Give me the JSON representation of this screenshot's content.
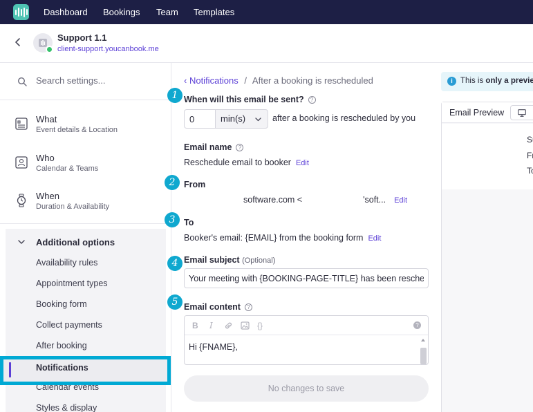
{
  "topnav": {
    "items": [
      "Dashboard",
      "Bookings",
      "Team",
      "Templates"
    ]
  },
  "header": {
    "title": "Support 1.1",
    "url": "client-support.youcanbook.me"
  },
  "sidebar": {
    "search_placeholder": "Search settings...",
    "sections": [
      {
        "title": "What",
        "subtitle": "Event details & Location"
      },
      {
        "title": "Who",
        "subtitle": "Calendar & Teams"
      },
      {
        "title": "When",
        "subtitle": "Duration & Availability"
      }
    ],
    "additional": {
      "title": "Additional options",
      "items": [
        "Availability rules",
        "Appointment types",
        "Booking form",
        "Collect payments",
        "After booking",
        "Notifications",
        "Calendar events",
        "Styles & display"
      ],
      "active": "Notifications"
    }
  },
  "main": {
    "breadcrumb": {
      "link": "Notifications",
      "separator": "/",
      "current": "After a booking is rescheduled"
    },
    "steps": [
      "1",
      "2",
      "3",
      "4",
      "5"
    ],
    "when": {
      "label": "When will this email be sent?",
      "value": "0",
      "unit": "min(s)",
      "after_text": "after a booking is rescheduled by you"
    },
    "email_name": {
      "label": "Email name",
      "value": "Reschedule email to booker",
      "edit": "Edit"
    },
    "from": {
      "label": "From",
      "value_left": "software.com <",
      "value_right": "'soft...",
      "edit": "Edit"
    },
    "to": {
      "label": "To",
      "value": "Booker's email: {EMAIL} from the booking form",
      "edit": "Edit"
    },
    "subject": {
      "label": "Email subject",
      "optional": "(Optional)",
      "value": "Your meeting with {BOOKING-PAGE-TITLE} has been rescheduled"
    },
    "content": {
      "label": "Email content",
      "toolbar": {
        "bold": "B",
        "italic": "I",
        "link": "link-icon",
        "image": "image-icon",
        "code": "{}",
        "help": "?"
      },
      "body": "Hi {FNAME},"
    },
    "save_button": "No changes to save"
  },
  "preview": {
    "banner_prefix": "This is ",
    "banner_bold": "only a preview",
    "title": "Email Preview",
    "lines": [
      "Su",
      "Fr",
      "To"
    ]
  },
  "colors": {
    "nav_bg": "#1d1f45",
    "accent": "#5b3fd6",
    "step_badge": "#0fa8cf",
    "highlight": "#00a9d4"
  }
}
